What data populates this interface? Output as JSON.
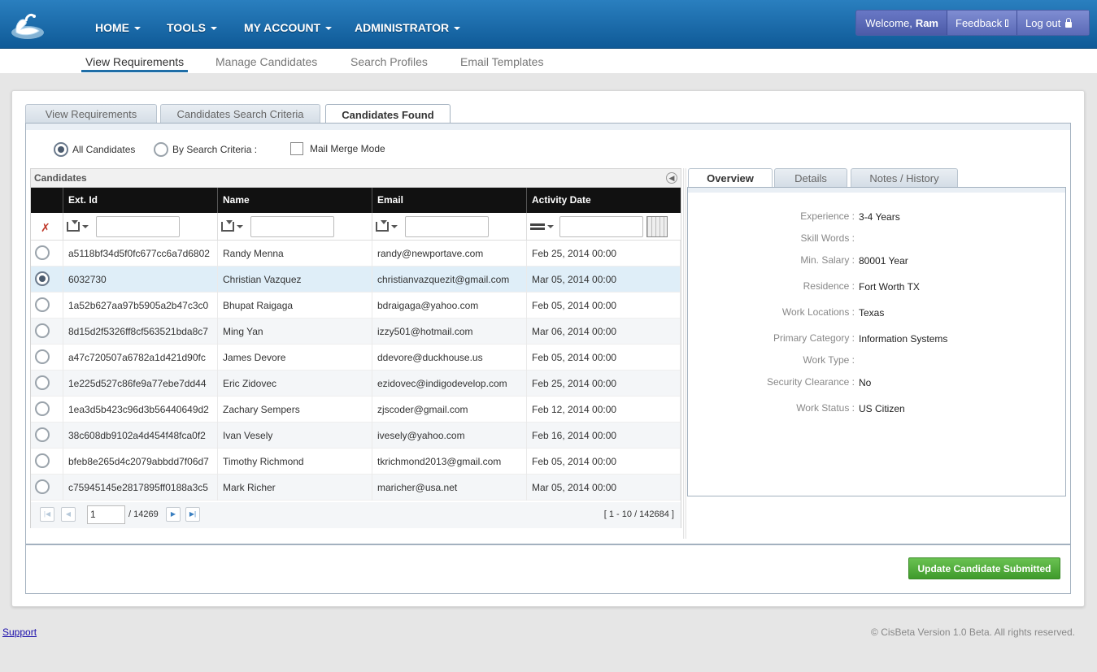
{
  "colors": {
    "nav_bg": "#1a6aa8",
    "accent": "#1f6ea7",
    "update_button": "#4fae3b",
    "header_bg": "#111111"
  },
  "nav": {
    "logo": "swan-logo",
    "items": [
      {
        "label": "HOME"
      },
      {
        "label": "TOOLS"
      },
      {
        "label": "MY ACCOUNT"
      },
      {
        "label": "ADMINISTRATOR"
      }
    ],
    "welcome_prefix": "Welcome,",
    "user_name": "Ram",
    "feedback_label": "Feedback",
    "logout_label": "Log out"
  },
  "subnav": {
    "items": [
      {
        "label": "View Requirements",
        "active": true
      },
      {
        "label": "Manage Candidates"
      },
      {
        "label": "Search Profiles"
      },
      {
        "label": "Email Templates"
      }
    ]
  },
  "tabs": [
    {
      "label": "View Requirements"
    },
    {
      "label": "Candidates Search Criteria"
    },
    {
      "label": "Candidates Found",
      "active": true
    }
  ],
  "options": {
    "all_candidates": "All Candidates",
    "by_search_criteria": "By Search Criteria :",
    "mail_merge": "Mail Merge Mode",
    "selected": "all_candidates"
  },
  "grid": {
    "caption": "Candidates",
    "columns": [
      "Ext. Id",
      "Name",
      "Email",
      "Activity Date"
    ],
    "rows": [
      {
        "ext_id": "a5118bf34d5f0fc677cc6a7d6802",
        "name": "Randy Menna",
        "email": "randy@newportave.com",
        "date": "Feb 25, 2014 00:00"
      },
      {
        "ext_id": "6032730",
        "name": "Christian Vazquez",
        "email": "christianvazquezit@gmail.com",
        "date": "Mar 05, 2014 00:00",
        "selected": true
      },
      {
        "ext_id": "1a52b627aa97b5905a2b47c3c0",
        "name": "Bhupat Raigaga",
        "email": "bdraigaga@yahoo.com",
        "date": "Feb 05, 2014 00:00"
      },
      {
        "ext_id": "8d15d2f5326ff8cf563521bda8c7",
        "name": "Ming Yan",
        "email": "izzy501@hotmail.com",
        "date": "Mar 06, 2014 00:00"
      },
      {
        "ext_id": "a47c720507a6782a1d421d90fc",
        "name": "James Devore",
        "email": "ddevore@duckhouse.us",
        "date": "Feb 05, 2014 00:00"
      },
      {
        "ext_id": "1e225d527c86fe9a77ebe7dd44",
        "name": "Eric Zidovec",
        "email": "ezidovec@indigodevelop.com",
        "date": "Feb 25, 2014 00:00"
      },
      {
        "ext_id": "1ea3d5b423c96d3b56440649d2",
        "name": "Zachary Sempers",
        "email": "zjscoder@gmail.com",
        "date": "Feb 12, 2014 00:00"
      },
      {
        "ext_id": "38c608db9102a4d454f48fca0f2",
        "name": "Ivan Vesely",
        "email": "ivesely@yahoo.com",
        "date": "Feb 16, 2014 00:00"
      },
      {
        "ext_id": "bfeb8e265d4c2079abbdd7f06d7",
        "name": "Timothy Richmond",
        "email": "tkrichmond2013@gmail.com",
        "date": "Feb 05, 2014 00:00"
      },
      {
        "ext_id": "c75945145e2817895ff0188a3c5",
        "name": "Mark Richer",
        "email": "maricher@usa.net",
        "date": "Mar 05, 2014 00:00"
      }
    ],
    "pager": {
      "page": "1",
      "total_pages": "/ 14269",
      "range": "[ 1 - 10 / 142684 ]"
    }
  },
  "detail": {
    "tabs": [
      {
        "label": "Overview",
        "active": true
      },
      {
        "label": "Details"
      },
      {
        "label": "Notes / History"
      }
    ],
    "fields": [
      {
        "label": "Experience :",
        "value": "3-4 Years"
      },
      {
        "label": "Skill Words :",
        "value": ""
      },
      {
        "label": "Min. Salary :",
        "value": "80001 Year"
      },
      {
        "label": "Residence :",
        "value": "Fort Worth TX"
      },
      {
        "label": "Work Locations :",
        "value": "Texas"
      },
      {
        "label": "Primary Category :",
        "value": "Information Systems"
      },
      {
        "label": "Work Type :",
        "value": ""
      },
      {
        "label": "Security Clearance :",
        "value": "No"
      },
      {
        "label": "Work Status :",
        "value": "US Citizen"
      }
    ]
  },
  "actions": {
    "update_button": "Update Candidate Submitted"
  },
  "footer": {
    "support": "Support",
    "copyright": "© CisBeta Version 1.0 Beta. All rights reserved."
  }
}
